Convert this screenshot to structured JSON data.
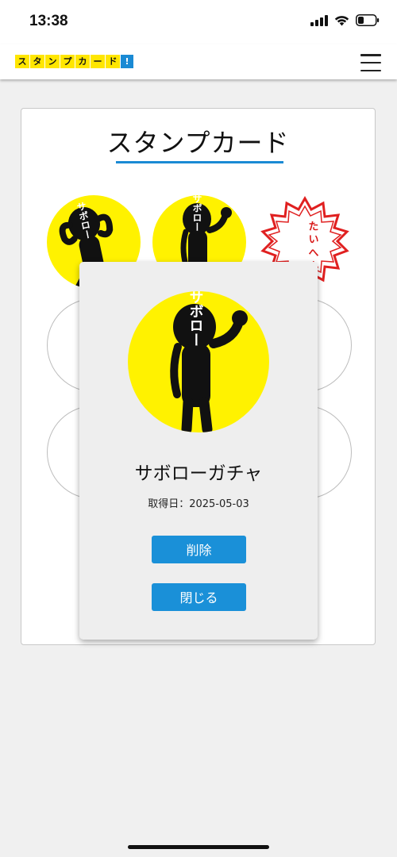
{
  "status_bar": {
    "time": "13:38"
  },
  "header": {
    "logo_chars": [
      "ス",
      "タ",
      "ン",
      "プ",
      "カ",
      "ー",
      "ド",
      "!"
    ],
    "menu_icon": "hamburger-menu-icon"
  },
  "card": {
    "title": "スタンプカード",
    "stamps": [
      {
        "state": "filled",
        "image": "saboro-character-arms-up",
        "label": "サボロー"
      },
      {
        "state": "filled",
        "image": "saboro-character-fist-raised",
        "label": "サボロー"
      },
      {
        "state": "filled",
        "image": "red-flower-seal",
        "label": "たいへんよくできました"
      },
      {
        "state": "empty"
      },
      {
        "state": "empty"
      },
      {
        "state": "empty"
      },
      {
        "state": "empty"
      }
    ],
    "accent_color": "#1a8ad4",
    "stamp_background": "#fff200"
  },
  "modal": {
    "stamp_label": "サボロー",
    "title": "サボローガチャ",
    "date_text": "取得日：2025-05-03",
    "delete_label": "削除",
    "close_label": "閉じる",
    "button_color": "#1a90d8"
  }
}
